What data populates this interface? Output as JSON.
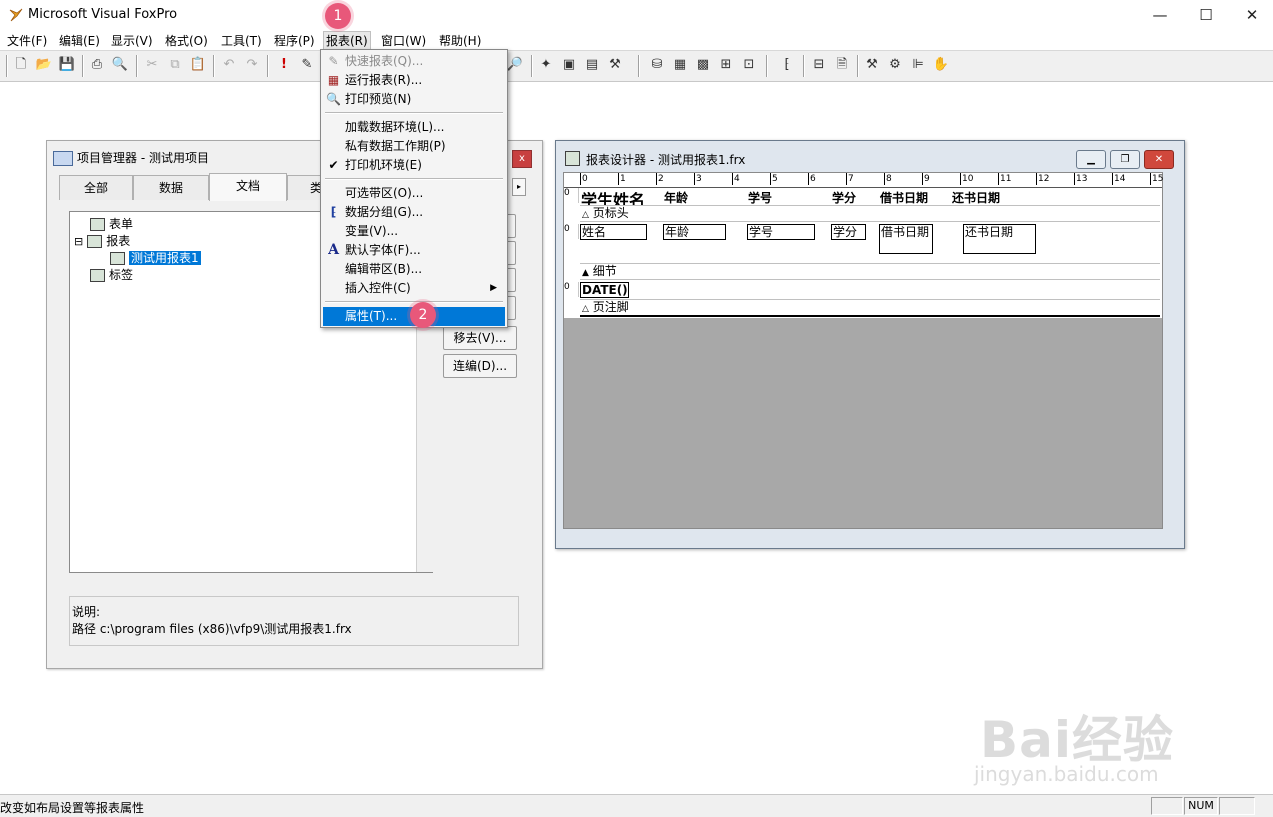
{
  "app": {
    "title": "Microsoft Visual FoxPro",
    "window_controls": {
      "minimize": "—",
      "maximize": "☐",
      "close": "✕"
    }
  },
  "menubar": {
    "items": [
      {
        "label": "文件(F)"
      },
      {
        "label": "编辑(E)"
      },
      {
        "label": "显示(V)"
      },
      {
        "label": "格式(O)"
      },
      {
        "label": "工具(T)"
      },
      {
        "label": "程序(P)"
      },
      {
        "label": "报表(R)",
        "active": true
      },
      {
        "label": "窗口(W)"
      },
      {
        "label": "帮助(H)"
      }
    ]
  },
  "badges": {
    "one": "1",
    "two": "2"
  },
  "report_menu": {
    "items": [
      {
        "label": "快速报表(Q)...",
        "disabled": true,
        "icon": "quick-report-icon"
      },
      {
        "label": "运行报表(R)...",
        "icon": "run-report-icon"
      },
      {
        "label": "打印预览(N)",
        "icon": "print-preview-icon"
      },
      {
        "label": "加载数据环境(L)..."
      },
      {
        "label": "私有数据工作期(P)"
      },
      {
        "label": "打印机环境(E)",
        "checked": true
      },
      {
        "label": "可选带区(O)..."
      },
      {
        "label": "数据分组(G)...",
        "icon": "data-group-icon"
      },
      {
        "label": "变量(V)..."
      },
      {
        "label": "默认字体(F)...",
        "icon": "font-icon"
      },
      {
        "label": "编辑带区(B)..."
      },
      {
        "label": "插入控件(C)",
        "submenu": true
      },
      {
        "label": "属性(T)...",
        "selected": true
      }
    ],
    "check_mark": "✔",
    "submenu_arrow": "▶",
    "font_glyph": "A"
  },
  "project_manager": {
    "title": "项目管理器 - 测试用项目",
    "close": "x",
    "tabs": [
      {
        "label": "全部"
      },
      {
        "label": "数据"
      },
      {
        "label": "文档",
        "active": true
      },
      {
        "label": "类"
      }
    ],
    "tree": [
      {
        "label": "表单",
        "level": 0
      },
      {
        "label": "报表",
        "level": 0,
        "expanded": true
      },
      {
        "label": "测试用报表1",
        "level": 1,
        "selected": true
      },
      {
        "label": "标签",
        "level": 0
      }
    ],
    "expander": "⊟",
    "buttons": [
      {
        "label": "移去(V)..."
      },
      {
        "label": "连编(D)..."
      }
    ],
    "description_label": "说明:",
    "path_text": "路径 c:\\program files (x86)\\vfp9\\测试用报表1.frx"
  },
  "report_designer": {
    "title": "报表设计器 - 测试用报表1.frx",
    "ruler": [
      "0",
      "1",
      "2",
      "3",
      "4",
      "5",
      "6",
      "7",
      "8",
      "9",
      "10",
      "11",
      "12",
      "13",
      "14",
      "15"
    ],
    "page_header_texts": {
      "name": "学生姓名",
      "age": "年龄",
      "id": "学号",
      "credit": "学分",
      "borrow": "借书日期",
      "return": "还书日期"
    },
    "bands": {
      "page_header": "页标头",
      "detail": "细节",
      "page_footer": "页注脚"
    },
    "detail_fields": {
      "name": "姓名",
      "age": "年龄",
      "id": "学号",
      "credit": "学分",
      "borrow": "借书日期",
      "return": "还书日期"
    },
    "footer_field": "DATE()",
    "row_zero": "0"
  },
  "statusbar": {
    "message": "改变如布局设置等报表属性",
    "num": "NUM"
  },
  "watermark": {
    "main": "Bai经验",
    "sub": "jingyan.baidu.com"
  }
}
